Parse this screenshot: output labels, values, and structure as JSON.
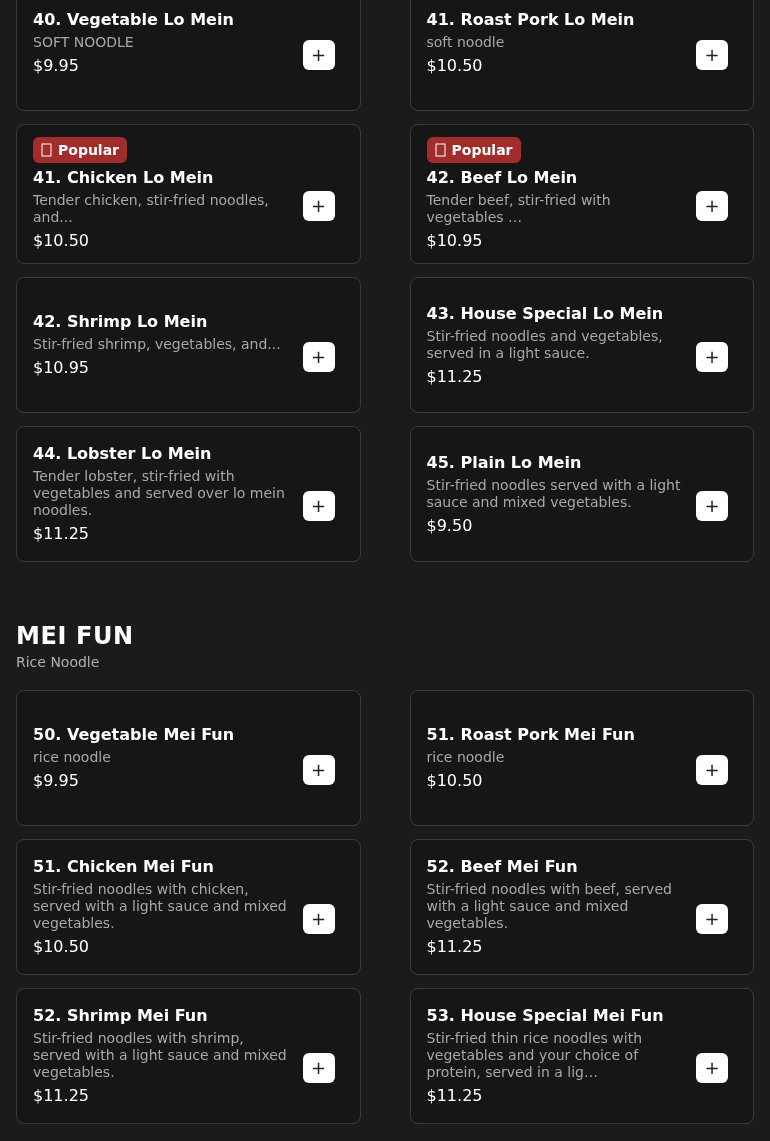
{
  "sections": [
    {
      "items": [
        {
          "name": "40. Vegetable Lo Mein",
          "description": "SOFT NOODLE",
          "price": "$9.95",
          "add": "+"
        },
        {
          "name": "41. Roast Pork Lo Mein",
          "description": "soft noodle",
          "price": "$10.50",
          "add": "+"
        },
        {
          "badge": "Popular",
          "name": "41. Chicken Lo Mein",
          "description": "Tender chicken, stir-fried noodles, and...",
          "price": "$10.50",
          "add": "+"
        },
        {
          "badge": "Popular",
          "name": "42. Beef Lo Mein",
          "description": "Tender beef, stir-fried with vegetables …",
          "price": "$10.95",
          "add": "+"
        },
        {
          "name": "42. Shrimp Lo Mein",
          "description": "Stir-fried shrimp, vegetables, and...",
          "price": "$10.95",
          "add": "+"
        },
        {
          "name": "43. House Special Lo Mein",
          "description": "Stir-fried noodles and vegetables, served in a light sauce.",
          "price": "$11.25",
          "add": "+"
        },
        {
          "name": "44. Lobster Lo Mein",
          "description": "Tender lobster, stir-fried with vegetables and served over lo mein noodles.",
          "price": "$11.25",
          "add": "+"
        },
        {
          "name": "45. Plain Lo Mein",
          "description": "Stir-fried noodles served with a light sauce and mixed vegetables.",
          "price": "$9.50",
          "add": "+"
        }
      ]
    },
    {
      "title": "MEI FUN",
      "subtitle": "Rice Noodle",
      "items": [
        {
          "name": "50. Vegetable Mei Fun",
          "description": "rice noodle",
          "price": "$9.95",
          "add": "+"
        },
        {
          "name": "51. Roast Pork Mei Fun",
          "description": "rice noodle",
          "price": "$10.50",
          "add": "+"
        },
        {
          "name": "51. Chicken Mei Fun",
          "description": "Stir-fried noodles with chicken, served with a light sauce and mixed vegetables.",
          "price": "$10.50",
          "add": "+"
        },
        {
          "name": "52. Beef Mei Fun",
          "description": "Stir-fried noodles with beef, served with a light sauce and mixed vegetables.",
          "price": "$11.25",
          "add": "+"
        },
        {
          "name": "52. Shrimp Mei Fun",
          "description": "Stir-fried noodles with shrimp, served with a light sauce and mixed vegetables.",
          "price": "$11.25",
          "add": "+"
        },
        {
          "name": "53. House Special Mei Fun",
          "description": "Stir-fried thin rice noodles with vegetables and your choice of protein, served in a lig…",
          "price": "$11.25",
          "add": "+"
        }
      ]
    }
  ]
}
